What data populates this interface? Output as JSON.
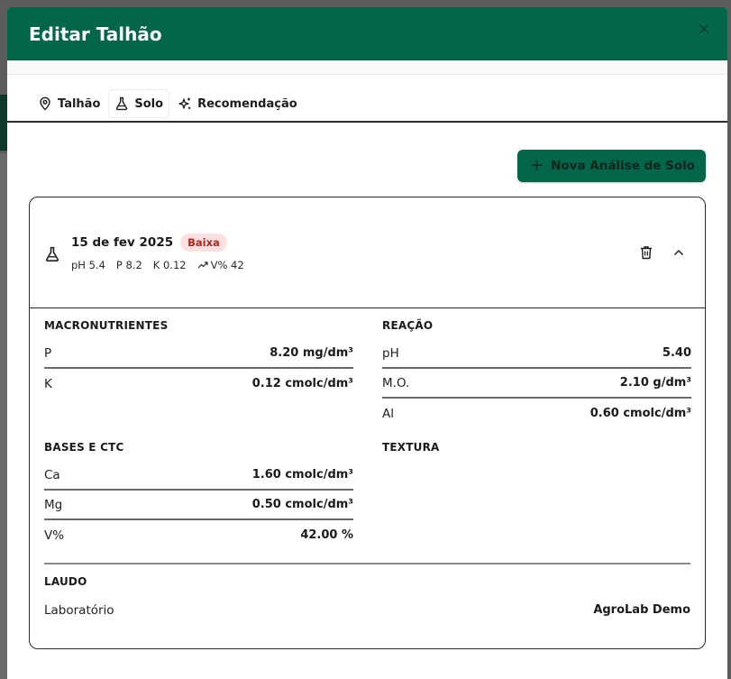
{
  "modal": {
    "title": "Editar Talhão"
  },
  "tabs": [
    {
      "label": "Talhão",
      "icon": "map-pin-icon"
    },
    {
      "label": "Solo",
      "icon": "flask-icon"
    },
    {
      "label": "Recomendação",
      "icon": "sparkles-icon"
    }
  ],
  "actions": {
    "new_analysis_label": "Nova Análise de Solo"
  },
  "analysis": {
    "date": "15 de fev 2025",
    "badge": "Baixa",
    "stats": {
      "ph": "pH 5.4",
      "p": "P 8.2",
      "k": "K 0.12",
      "v": "V% 42"
    },
    "macronutrientes": {
      "title": "MACRONUTRIENTES",
      "rows": [
        {
          "label": "P",
          "value": "8.20 mg/dm³"
        },
        {
          "label": "K",
          "value": "0.12 cmolc/dm³"
        }
      ]
    },
    "reacao": {
      "title": "REAÇÃO",
      "rows": [
        {
          "label": "pH",
          "value": "5.40"
        },
        {
          "label": "M.O.",
          "value": "2.10 g/dm³"
        },
        {
          "label": "Al",
          "value": "0.60 cmolc/dm³"
        }
      ]
    },
    "bases": {
      "title": "BASES E CTC",
      "rows": [
        {
          "label": "Ca",
          "value": "1.60 cmolc/dm³"
        },
        {
          "label": "Mg",
          "value": "0.50 cmolc/dm³"
        },
        {
          "label": "V%",
          "value": "42.00 %"
        }
      ]
    },
    "textura": {
      "title": "TEXTURA"
    },
    "laudo": {
      "title": "LAUDO",
      "label": "Laboratório",
      "value": "AgroLab Demo"
    }
  },
  "colors": {
    "primary": "#036649",
    "badge_bg": "#fde1e1",
    "badge_text": "#b3261e"
  }
}
